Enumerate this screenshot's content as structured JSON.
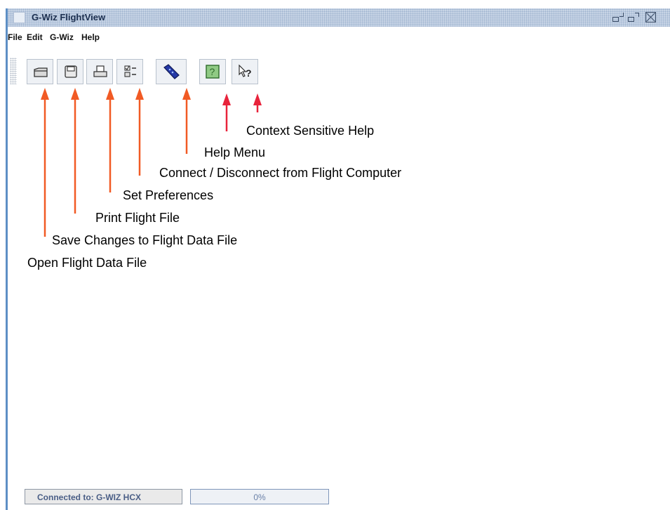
{
  "window": {
    "title": "G-Wiz FlightView"
  },
  "menubar": {
    "items": [
      "File",
      "Edit",
      "G-Wiz",
      "Help"
    ]
  },
  "toolbar": {
    "buttons": [
      {
        "icon": "open-folder-icon"
      },
      {
        "icon": "save-disk-icon"
      },
      {
        "icon": "printer-icon"
      },
      {
        "icon": "preferences-checklist-icon"
      },
      {
        "icon": "flight-computer-connect-icon"
      },
      {
        "icon": "help-book-icon"
      },
      {
        "icon": "context-help-arrow-icon"
      }
    ],
    "context_help_glyph": "?"
  },
  "annotations": {
    "context_help": "Context Sensitive Help",
    "help_menu": "Help Menu",
    "connect": "Connect / Disconnect from Flight Computer",
    "preferences": "Set Preferences",
    "print": "Print Flight File",
    "save": "Save Changes to Flight Data File",
    "open": "Open Flight Data File"
  },
  "statusbar": {
    "connection": "Connected to: G-WIZ HCX",
    "progress": "0%"
  },
  "colors": {
    "arrow": "#f15a24",
    "title_text": "#1c2f4f",
    "status_text": "#4a5e86"
  }
}
